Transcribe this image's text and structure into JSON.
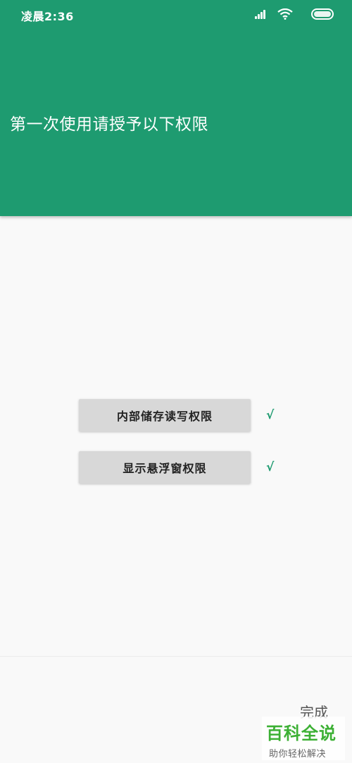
{
  "status_bar": {
    "time": "凌晨2:36",
    "icons": [
      "signal-icon",
      "wifi-icon",
      "battery-icon"
    ]
  },
  "header": {
    "title": "第一次使用请授予以下权限"
  },
  "permissions": [
    {
      "label": "内部储存读写权限",
      "status": "√"
    },
    {
      "label": "显示悬浮窗权限",
      "status": "√"
    }
  ],
  "footer": {
    "done_label": "完成"
  },
  "watermark": {
    "title": "百科全说",
    "subtitle": "助你轻松解决"
  },
  "colors": {
    "accent": "#1e9b70",
    "background": "#f9f9f9",
    "button": "#d8d8d8"
  }
}
